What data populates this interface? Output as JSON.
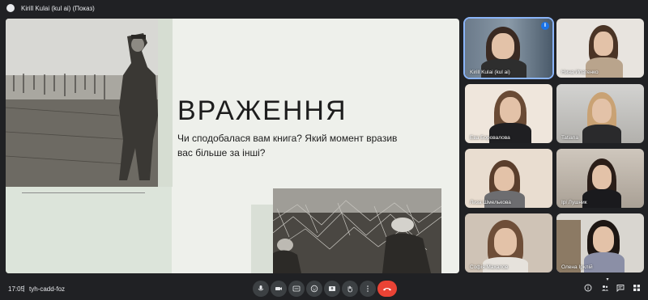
{
  "topbar": {
    "presenter_label": "Kirill Kulai (kul ai) (Показ)"
  },
  "slide": {
    "title": "ВРАЖЕННЯ",
    "question": "Чи сподобалася вам книга? Який момент вразив вас більше за інші?"
  },
  "participants": [
    {
      "name": "Kirill Kulai (kul ai)",
      "active": true
    },
    {
      "name": "Нина Ипатенко"
    },
    {
      "name": "Ева Боровалова"
    },
    {
      "name": "Tatiana"
    },
    {
      "name": "Лиза Шмелькова"
    },
    {
      "name": "Ірі Лушник"
    },
    {
      "name": "Софія Махалов"
    },
    {
      "name": "Олена Ірклій"
    }
  ],
  "bottombar": {
    "time": "17:05",
    "meeting_code": "tyh-cadd-foz"
  },
  "colors": {
    "end_call": "#ea4335",
    "active_outline": "#8ab4f8",
    "background": "#202124"
  }
}
